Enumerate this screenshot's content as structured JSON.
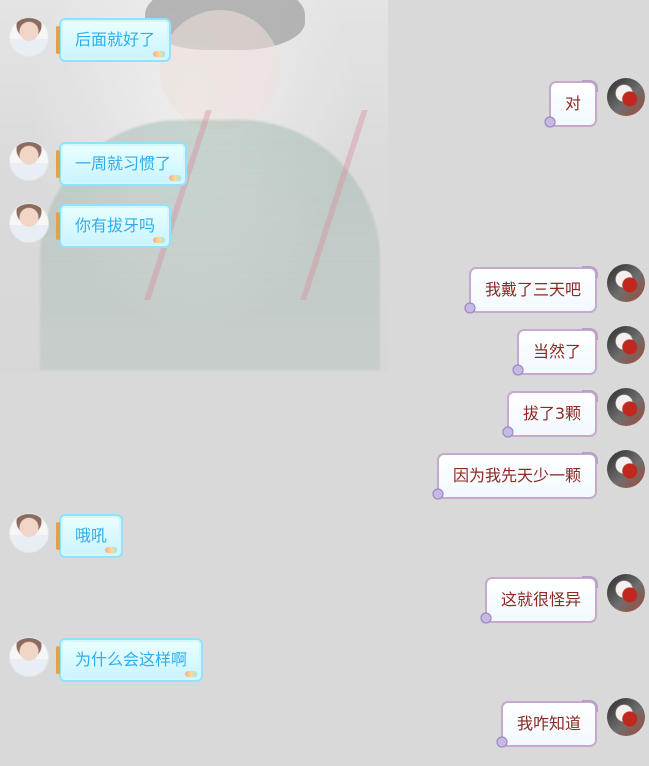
{
  "chat": {
    "messages": [
      {
        "side": "left",
        "text": "后面就好了"
      },
      {
        "side": "right",
        "text": "对"
      },
      {
        "side": "left",
        "text": "一周就习惯了"
      },
      {
        "side": "left",
        "text": "你有拔牙吗"
      },
      {
        "side": "right",
        "text": "我戴了三天吧"
      },
      {
        "side": "right",
        "text": "当然了"
      },
      {
        "side": "right",
        "text": "拔了3颗"
      },
      {
        "side": "right",
        "text": "因为我先天少一颗"
      },
      {
        "side": "left",
        "text": "哦吼"
      },
      {
        "side": "right",
        "text": "这就很怪异"
      },
      {
        "side": "left",
        "text": "为什么会这样啊"
      },
      {
        "side": "right",
        "text": "我咋知道"
      }
    ]
  }
}
